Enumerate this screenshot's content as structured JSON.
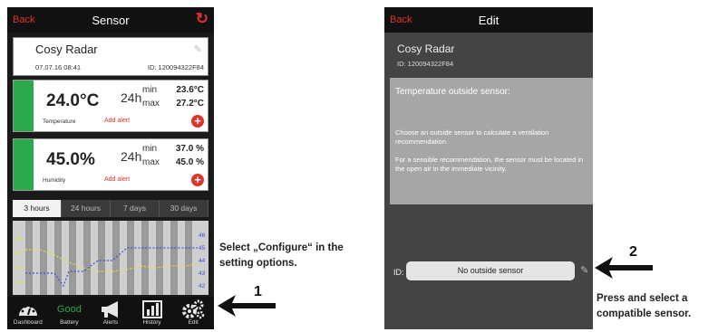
{
  "left_screen": {
    "header": {
      "back": "Back",
      "title": "Sensor",
      "refresh_icon": "refresh-icon"
    },
    "device": {
      "name": "Cosy Radar",
      "date": "07.07.16 08:41",
      "id": "ID: 120094322F84"
    },
    "temperature": {
      "value": "24.0°C",
      "period": "24h",
      "min_label": "min",
      "max_label": "max",
      "min": "23.6°C",
      "max": "27.2°C",
      "label": "Temperature",
      "alert": "Add alert",
      "plus": "+"
    },
    "humidity": {
      "value": "45.0%",
      "period": "24h",
      "min_label": "min",
      "max_label": "max",
      "min": "37.0 %",
      "max": "45.0 %",
      "label": "Humidity",
      "alert": "Add alert",
      "plus": "+"
    },
    "range_tabs": [
      "3 hours",
      "24 hours",
      "7 days",
      "30 days"
    ],
    "active_tab": "3 hours",
    "chart": {
      "left_ticks": [
        "26",
        "25",
        "24",
        "23"
      ],
      "right_ticks": [
        "46",
        "45",
        "44",
        "43",
        "42"
      ]
    },
    "nav": [
      {
        "label": "Dashboard",
        "icon": "dashboard-gauge-icon"
      },
      {
        "label": "Battery",
        "status": "Good"
      },
      {
        "label": "Alerts",
        "icon": "megaphone-icon"
      },
      {
        "label": "History",
        "icon": "bar-chart-icon"
      },
      {
        "label": "Edit",
        "icon": "gears-icon"
      }
    ]
  },
  "right_screen": {
    "header": {
      "back": "Back",
      "title": "Edit"
    },
    "device": {
      "name": "Cosy Radar",
      "id": "ID: 120094322F84"
    },
    "panel": {
      "title": "Temperature outside sensor:",
      "text1": "Choose an outside sensor to calculate a ventilation recommendation.",
      "text2": "For a sensible recommendation, the sensor must be located in the open air in the immediate vicinity."
    },
    "id_label": "ID:",
    "id_value": "No outside sensor"
  },
  "annotations": {
    "step1": "1",
    "caption1": "Select „Configure“ in the setting options.",
    "step2": "2",
    "caption2": "Press and select a compatible sensor."
  },
  "colors": {
    "accent_red": "#e0332b",
    "green": "#2aa84a"
  }
}
